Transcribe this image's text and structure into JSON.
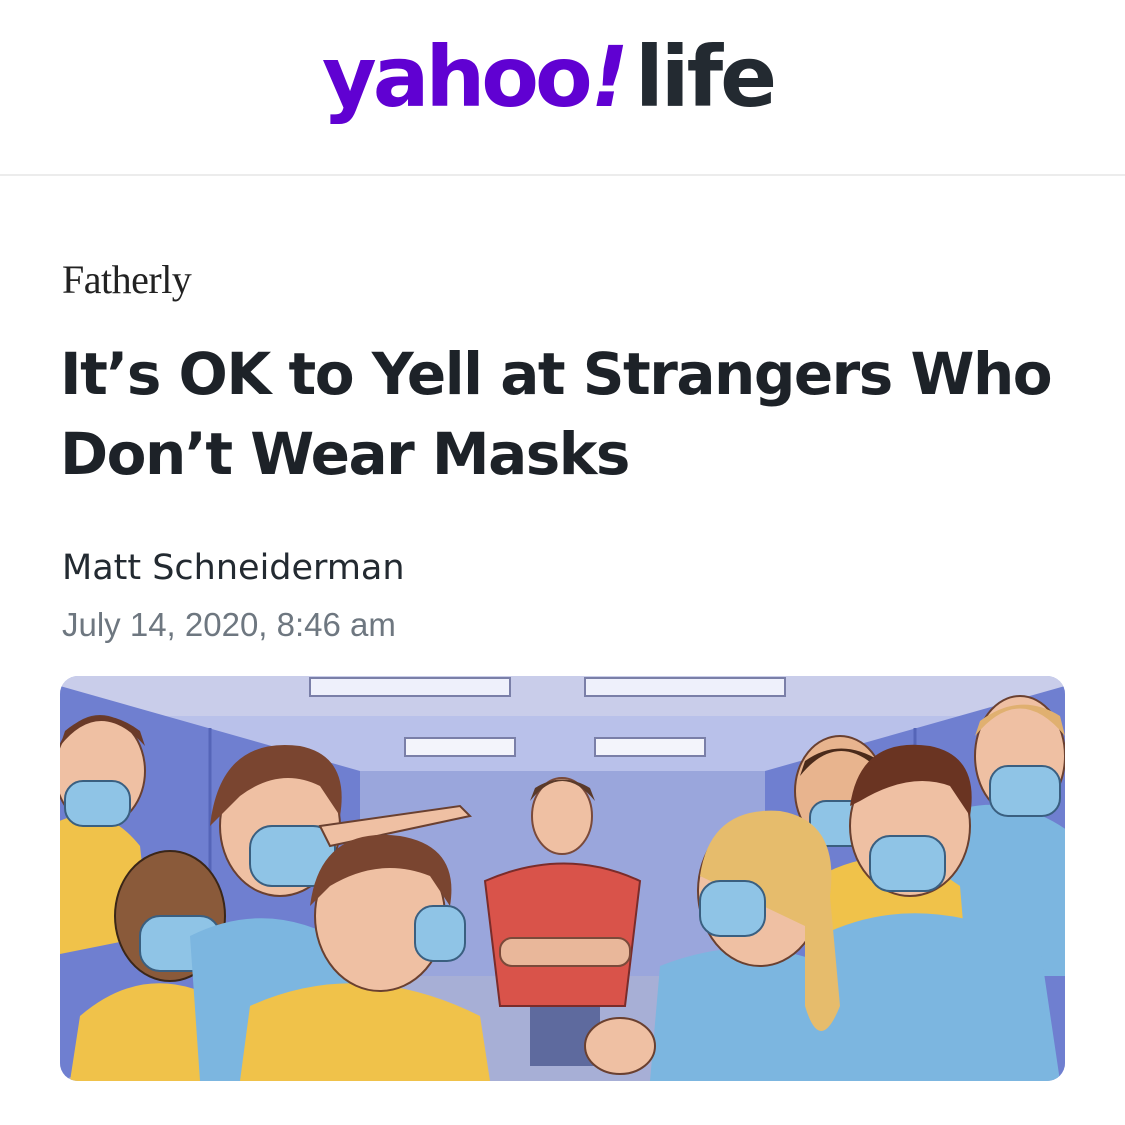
{
  "header": {
    "logo": {
      "brand_text": "yahoo",
      "bang_text": "!",
      "section_text": "life",
      "brand_color": "#6001d2",
      "section_color": "#232a31"
    }
  },
  "article": {
    "publisher": "Fatherly",
    "headline": "It’s OK to Yell at Strangers Who Don’t Wear Masks",
    "author": "Matt Schneiderman",
    "date": "July 14, 2020, 8:46 am",
    "hero_image": {
      "description_icon": "illustration-image"
    }
  },
  "colors": {
    "headline": "#1d2228",
    "date": "#6e7780",
    "mask_blue": "#8fc4e6",
    "shirt_red": "#d9534a",
    "shirt_yellow": "#f0c24a",
    "wall_blue": "#6f7fd0"
  }
}
